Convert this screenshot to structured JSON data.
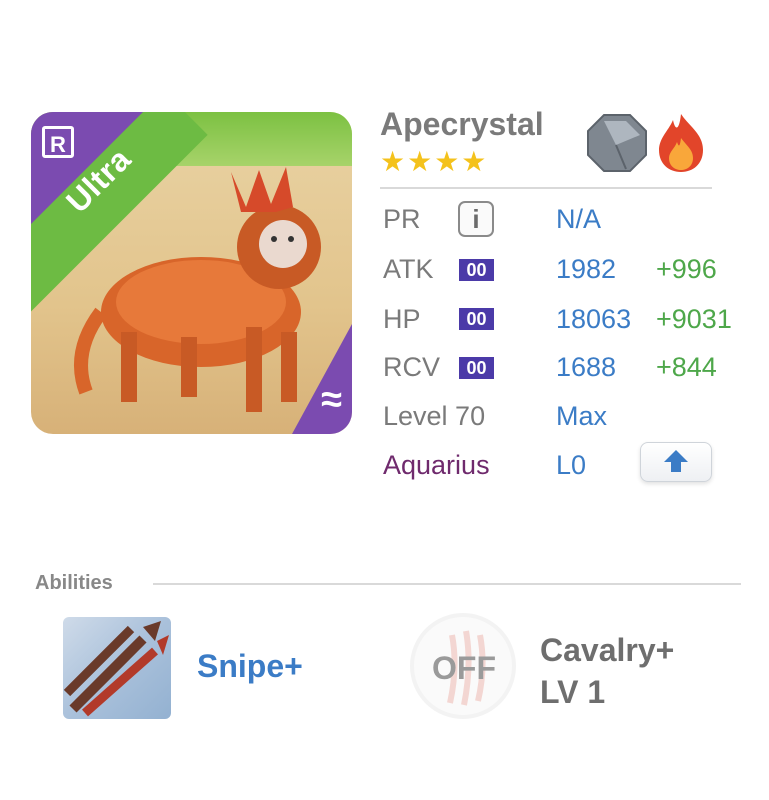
{
  "unit": {
    "name": "Apecrystal",
    "rarity_label": "Ultra",
    "badge": "R",
    "stars": "★★★★",
    "star_count": 4,
    "element_icons": [
      "stone-octagon-icon",
      "fire-icon"
    ],
    "portrait_corner_glyph": "≈"
  },
  "stats": {
    "pr": {
      "label": "PR",
      "value": "N/A"
    },
    "atk": {
      "label": "ATK",
      "box": "00",
      "value": "1982",
      "plus": "+996"
    },
    "hp": {
      "label": "HP",
      "box": "00",
      "value": "18063",
      "plus": "+9031"
    },
    "rcv": {
      "label": "RCV",
      "box": "00",
      "value": "1688",
      "plus": "+844"
    },
    "level": {
      "label": "Level 70",
      "value": "Max"
    },
    "sign": {
      "label": "Aquarius",
      "value": "L0"
    }
  },
  "abilities": {
    "title": "Abilities",
    "skill": {
      "name": "Snipe+",
      "icon": "arrows-icon"
    },
    "passive": {
      "state": "OFF",
      "name": "Cavalry+",
      "level": "LV 1",
      "icon": "claw-icon"
    }
  },
  "colors": {
    "accent_blue": "#3b7cc6",
    "plus_green": "#4ea74a",
    "stat_box_purple": "#4b3aa8",
    "aquarius_purple": "#6f2a6d",
    "star_yellow": "#f4c21c"
  }
}
